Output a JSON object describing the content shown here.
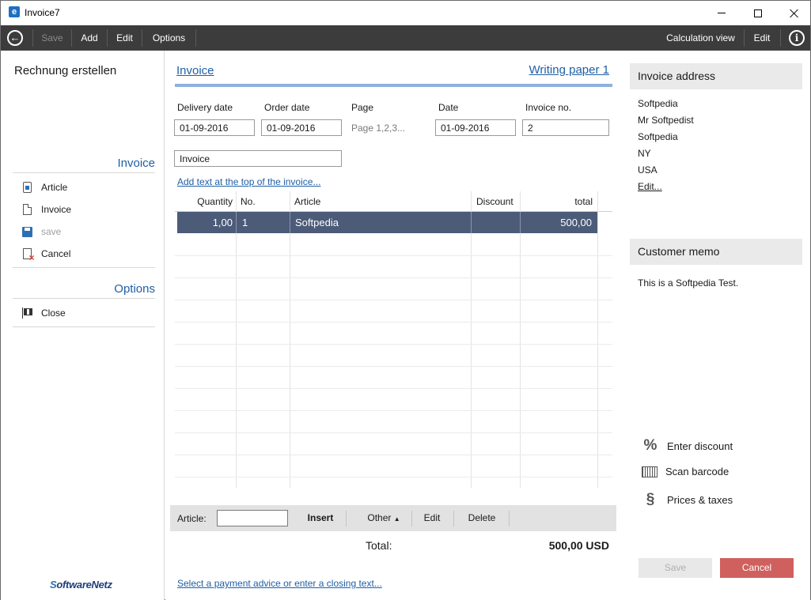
{
  "window": {
    "title": "Invoice7",
    "icon_letter": "e"
  },
  "toolbar": {
    "save": "Save",
    "add": "Add",
    "edit": "Edit",
    "options": "Options",
    "calc_view": "Calculation view",
    "edit_right": "Edit",
    "info_glyph": "i",
    "back_glyph": "←"
  },
  "sidebar": {
    "title": "Rechnung erstellen",
    "invoice_section": "Invoice",
    "items": [
      {
        "label": "Article",
        "icon": "article-icon",
        "enabled": true
      },
      {
        "label": "Invoice",
        "icon": "document-icon",
        "enabled": true
      },
      {
        "label": "save",
        "icon": "save-disk-icon",
        "enabled": false
      },
      {
        "label": "Cancel",
        "icon": "cancel-document-icon",
        "enabled": true
      }
    ],
    "options_section": "Options",
    "close_label": "Close",
    "logo_a": "S",
    "logo_b": "oftwareNetz"
  },
  "main": {
    "tab_invoice": "Invoice",
    "tab_writing_paper": "Writing paper 1",
    "fields": {
      "delivery_date_label": "Delivery date",
      "delivery_date": "01-09-2016",
      "order_date_label": "Order date",
      "order_date": "01-09-2016",
      "page_label": "Page",
      "page_value": "Page 1,2,3...",
      "date_label": "Date",
      "date": "01-09-2016",
      "invoice_no_label": "Invoice no.",
      "invoice_no": "2"
    },
    "doc_title": "Invoice",
    "add_text_top": "Add text at the top of the invoice...",
    "grid": {
      "headers": {
        "quantity": "Quantity",
        "no": "No.",
        "article": "Article",
        "discount": "Discount",
        "total": "total"
      },
      "rows": [
        {
          "quantity": "1,00",
          "no": "1",
          "article": "Softpedia",
          "discount": "",
          "total": "500,00"
        }
      ]
    },
    "article_bar": {
      "label": "Article:",
      "insert": "Insert",
      "other": "Other",
      "other_arrow": "▲",
      "edit": "Edit",
      "delete": "Delete"
    },
    "total_label": "Total:",
    "total_value": "500,00 USD",
    "closing_text": "Select a payment advice or enter a closing text..."
  },
  "right": {
    "address_header": "Invoice address",
    "address_lines": [
      "Softpedia",
      "Mr Softpedist",
      "Softpedia",
      "NY",
      "USA"
    ],
    "address_edit": "Edit...",
    "memo_header": "Customer memo",
    "memo_text": "This is a Softpedia Test.",
    "tools": {
      "discount": "Enter discount",
      "discount_glyph": "%",
      "barcode": "Scan barcode",
      "prices": "Prices & taxes",
      "prices_glyph": "§"
    },
    "save_btn": "Save",
    "cancel_btn": "Cancel",
    "colors": {
      "cancel": "#d0605e",
      "selection": "#4c5b78",
      "link": "#1f5fa6",
      "toolbar": "#3c3c3c"
    }
  }
}
